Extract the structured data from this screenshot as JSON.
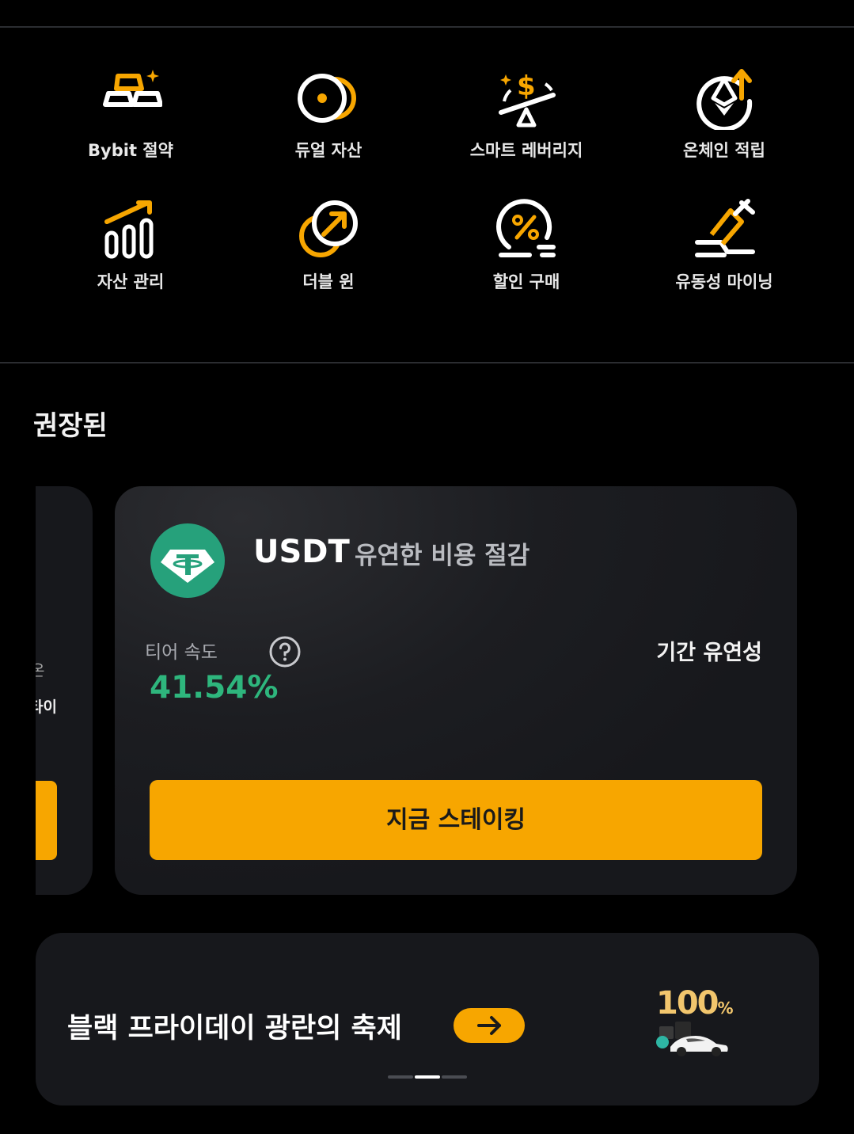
{
  "menu": {
    "items": [
      {
        "label": "Bybit 절약",
        "icon": "gold-bars-icon"
      },
      {
        "label": "듀얼 자산",
        "icon": "dual-coins-icon"
      },
      {
        "label": "스마트 레버리지",
        "icon": "dollar-seesaw-icon"
      },
      {
        "label": "온체인 적립",
        "icon": "eth-earn-icon"
      },
      {
        "label": "자산 관리",
        "icon": "growth-bars-icon"
      },
      {
        "label": "더블 윈",
        "icon": "double-win-icon"
      },
      {
        "label": "할인 구매",
        "icon": "discount-icon"
      },
      {
        "label": "유동성 마이닝",
        "icon": "mining-pickaxe-icon"
      }
    ]
  },
  "recommended": {
    "title": "권장된",
    "peek_card": {
      "line1": "온",
      "line2": "타이"
    },
    "card": {
      "token": "USDT",
      "description": "유연한 비용 절감",
      "rate_label": "티어 속도",
      "rate_value": "41.54%",
      "term_label": "기간 유연성",
      "button_label": "지금 스테이킹"
    }
  },
  "banner": {
    "text": "블랙 프라이데이 광란의 축제",
    "promo_number": "100",
    "promo_unit": "%"
  },
  "colors": {
    "accent": "#f7a600",
    "positive": "#2eb67d",
    "card_bg": "#17181c",
    "tether": "#26a17b"
  }
}
